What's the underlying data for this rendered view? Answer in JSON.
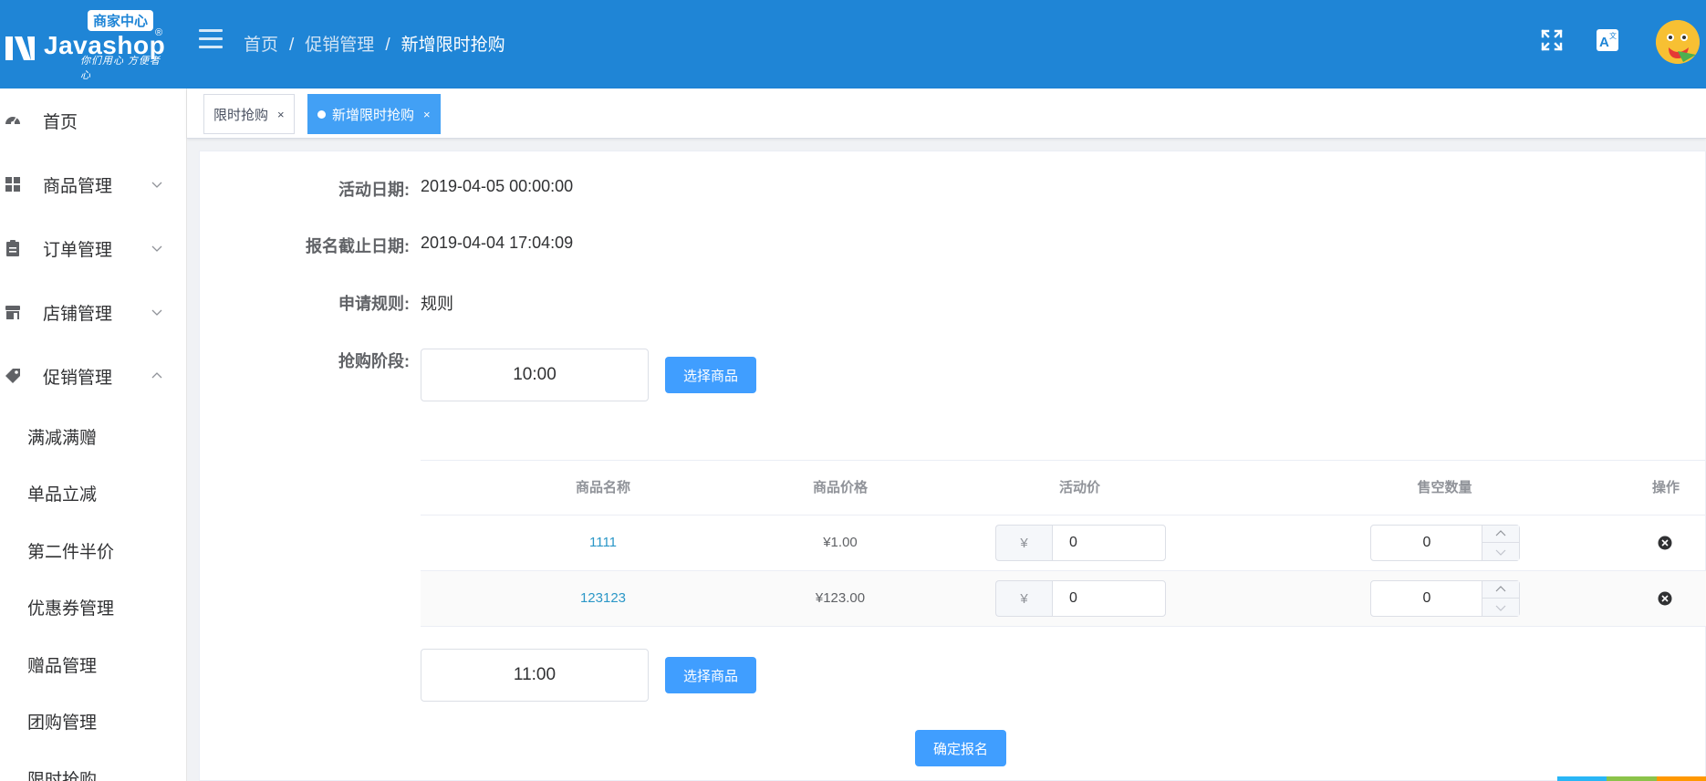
{
  "header": {
    "badge": "商家中心",
    "brand": "Javashop",
    "reg": "®",
    "slogan": "你们用心 方便者心",
    "breadcrumb": [
      "首页",
      "促销管理",
      "新增限时抢购"
    ],
    "sep": "/"
  },
  "sidebar": {
    "items": [
      {
        "label": "首页",
        "icon": "dashboard-icon"
      },
      {
        "label": "商品管理",
        "icon": "grid-icon"
      },
      {
        "label": "订单管理",
        "icon": "clipboard-icon"
      },
      {
        "label": "店铺管理",
        "icon": "store-icon"
      },
      {
        "label": "促销管理",
        "icon": "tag-icon"
      }
    ],
    "sub_items": [
      "满减满赠",
      "单品立减",
      "第二件半价",
      "优惠券管理",
      "赠品管理",
      "团购管理",
      "限时抢购"
    ]
  },
  "tabs": [
    {
      "label": "限时抢购",
      "close": "×"
    },
    {
      "label": "新增限时抢购",
      "close": "×"
    }
  ],
  "form": {
    "activity_date_label": "活动日期:",
    "activity_date": "2019-04-05 00:00:00",
    "deadline_label": "报名截止日期:",
    "deadline": "2019-04-04 17:04:09",
    "rules_label": "申请规则:",
    "rules": "规则",
    "stage_label": "抢购阶段:"
  },
  "stages": [
    {
      "time": "10:00",
      "select_label": "选择商品"
    },
    {
      "time": "11:00",
      "select_label": "选择商品"
    }
  ],
  "table": {
    "headers": [
      "商品名称",
      "商品价格",
      "活动价",
      "售空数量",
      "操作"
    ],
    "currency": "¥",
    "rows": [
      {
        "name": "1111",
        "price": "¥1.00",
        "activity_price": "0",
        "sold_out": "0"
      },
      {
        "name": "123123",
        "price": "¥123.00",
        "activity_price": "0",
        "sold_out": "0"
      }
    ]
  },
  "submit_label": "确定报名",
  "colors": {
    "header": "#1f85d6",
    "primary": "#409eff",
    "link": "#2b97c7"
  }
}
